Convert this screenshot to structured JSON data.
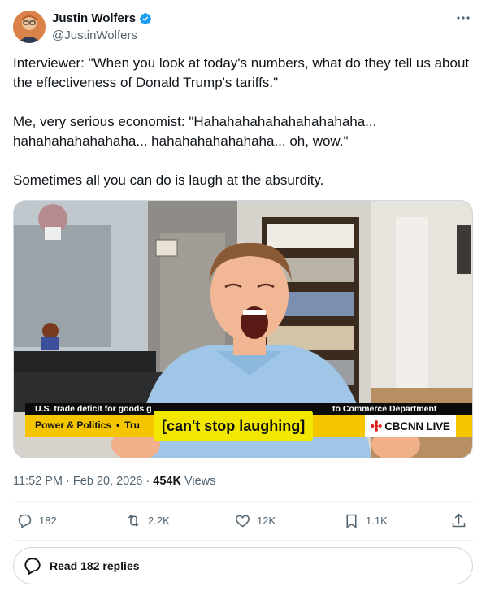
{
  "author": {
    "display_name": "Justin Wolfers",
    "handle": "@JustinWolfers",
    "verified": true,
    "avatar_icon": "avatar-photo",
    "verified_icon": "verified-badge-icon",
    "more_icon": "more-options-icon"
  },
  "tweet": {
    "paragraphs": [
      "Interviewer: \"When you look at today's numbers, what do they tell us about the effectiveness of Donald Trump's tariffs.\"",
      "Me, very serious economist: \"Hahahahahahahahahahaha... hahahahahahahaha... hahahahahahahaha... oh, wow.\"",
      "Sometimes all you can do is laugh at the absurdity."
    ]
  },
  "media": {
    "ticker_left": "U.S. trade deficit for goods g",
    "ticker_right": "to Commerce Department",
    "show_name": "Power & Politics",
    "show_separator": "▪",
    "show_topic": "Tru",
    "caption": "[can't stop laughing]",
    "network_label": "CBCNN LIVE"
  },
  "meta": {
    "time": "11:52 PM",
    "separator": "·",
    "date": "Feb 20, 2026",
    "views_count": "454K",
    "views_label": "Views"
  },
  "actions": {
    "replies": "182",
    "reposts": "2.2K",
    "likes": "12K",
    "bookmarks": "1.1K"
  },
  "read_replies": {
    "label": "Read 182 replies"
  },
  "colors": {
    "text_primary": "#0f1419",
    "text_secondary": "#536471",
    "verified_blue": "#1d9bf0",
    "border": "#cfd9de",
    "caption_yellow": "#f2e700",
    "lower_third_yellow": "#f5c500"
  }
}
